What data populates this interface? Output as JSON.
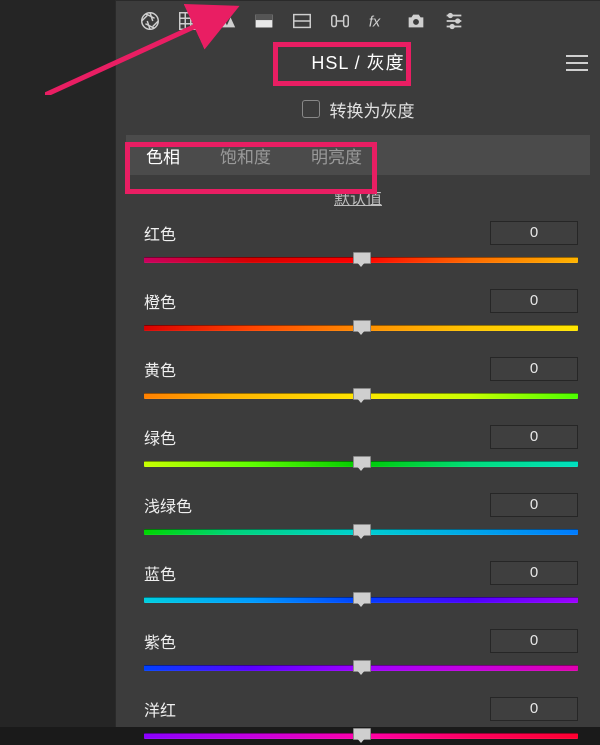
{
  "toolbar_icons": [
    "aperture",
    "grid",
    "triangles",
    "tone-active",
    "split",
    "lens",
    "fx",
    "camera",
    "sliders"
  ],
  "panel": {
    "title": "HSL / 灰度",
    "grayscale_label": "转换为灰度",
    "tabs": {
      "hue": "色相",
      "saturation": "饱和度",
      "luminance": "明亮度"
    },
    "default_link": "默认值"
  },
  "colors": {
    "accent": "#e91e63",
    "panel_bg": "#3c3c3c"
  },
  "sliders": {
    "red": {
      "label": "红色",
      "value": "0"
    },
    "orange": {
      "label": "橙色",
      "value": "0"
    },
    "yellow": {
      "label": "黄色",
      "value": "0"
    },
    "green": {
      "label": "绿色",
      "value": "0"
    },
    "aqua": {
      "label": "浅绿色",
      "value": "0"
    },
    "blue": {
      "label": "蓝色",
      "value": "0"
    },
    "purple": {
      "label": "紫色",
      "value": "0"
    },
    "magenta": {
      "label": "洋红",
      "value": "0"
    }
  }
}
